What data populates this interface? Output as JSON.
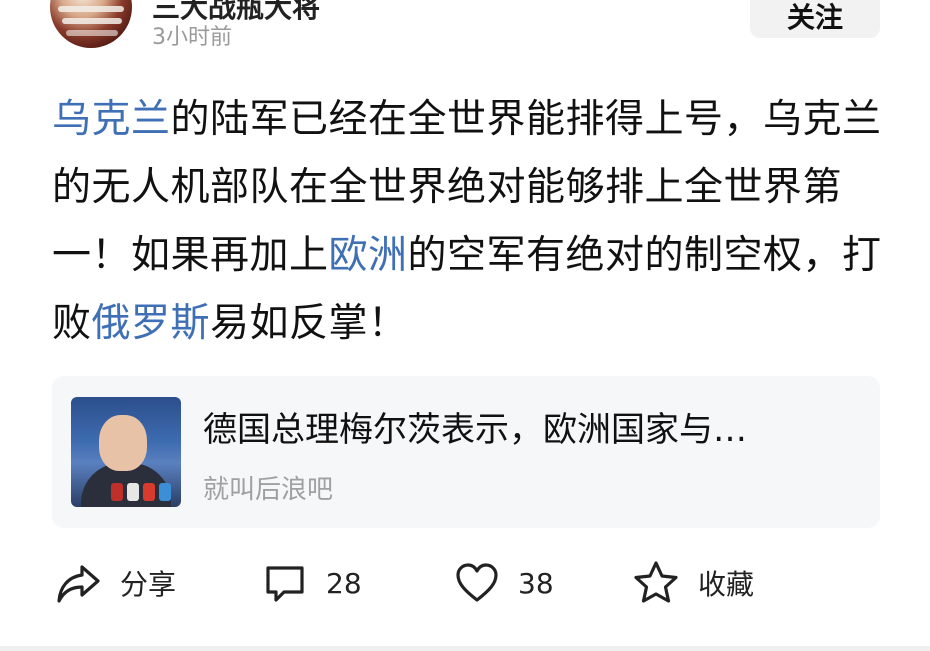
{
  "post": {
    "author_name": "三大战瓶大将",
    "time": "3小时前",
    "follow_label": "关注",
    "body_segments": [
      {
        "text": "乌克兰",
        "link": true
      },
      {
        "text": "的陆军已经在全世界能排得上号，乌克兰的无人机部队在全世界绝对能够排上全世界第一！如果再加上",
        "link": false
      },
      {
        "text": "欧洲",
        "link": true
      },
      {
        "text": "的空军有绝对的制空权，打败",
        "link": false
      },
      {
        "text": "俄罗斯",
        "link": true
      },
      {
        "text": "易如反掌！",
        "link": false
      }
    ]
  },
  "card": {
    "title": "德国总理梅尔茨表示，欧洲国家与…",
    "source": "就叫后浪吧"
  },
  "actions": {
    "share": {
      "icon": "share-icon",
      "label": "分享"
    },
    "comment": {
      "icon": "comment-icon",
      "label": "28"
    },
    "like": {
      "icon": "heart-icon",
      "label": "38"
    },
    "favorite": {
      "icon": "star-icon",
      "label": "收藏"
    }
  },
  "colors": {
    "link": "#3f6fb5",
    "secondary_text": "#9a9a9a",
    "card_bg": "#f6f7f9"
  }
}
